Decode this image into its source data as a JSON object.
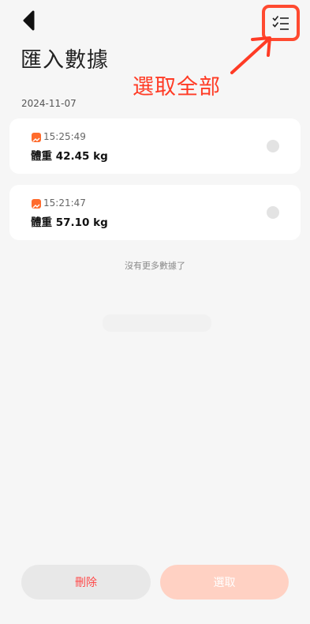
{
  "header": {
    "title": "匯入數據",
    "back_icon": "back-triangle-icon",
    "select_all_icon": "checklist-icon"
  },
  "annotation": {
    "label": "選取全部",
    "color": "#ff3b25"
  },
  "records": {
    "date": "2024-11-07",
    "items": [
      {
        "time": "15:25:49",
        "weight": "體重 42.45 kg",
        "selected": false
      },
      {
        "time": "15:21:47",
        "weight": "體重 57.10 kg",
        "selected": false
      }
    ],
    "end_text": "沒有更多數據了"
  },
  "footer": {
    "delete_label": "刪除",
    "select_label": "選取"
  },
  "colors": {
    "accent": "#ff6b2c",
    "delete_text": "#ff4a4a",
    "select_button": "#ffd1c3"
  }
}
